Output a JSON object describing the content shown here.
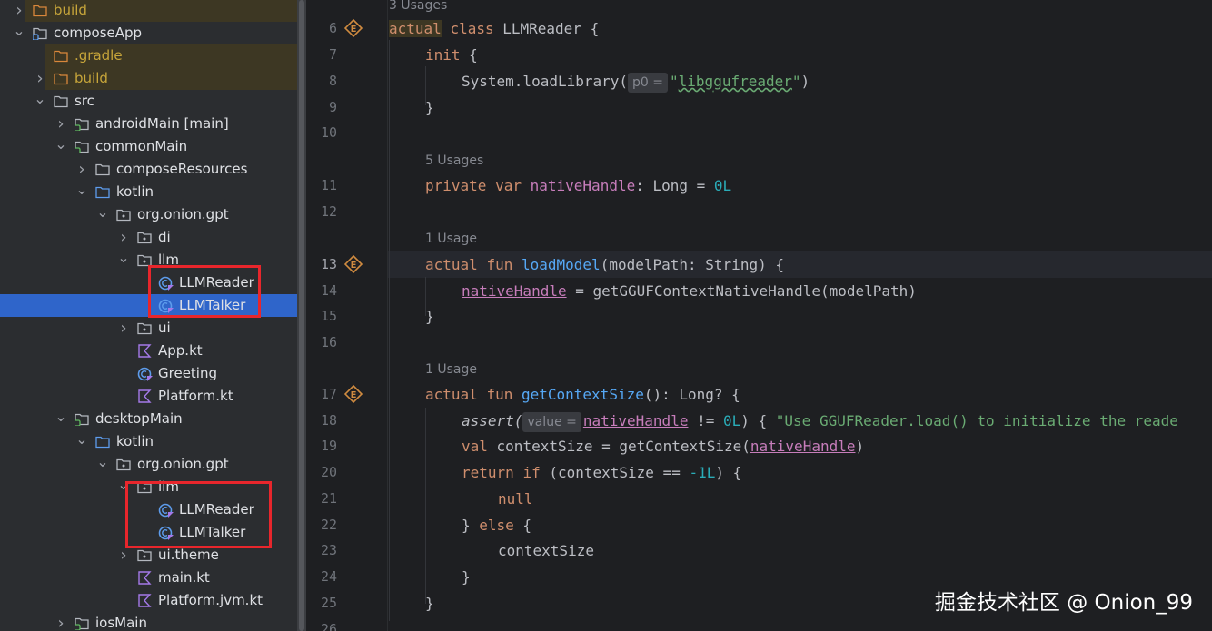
{
  "project_tree": [
    {
      "label": "build",
      "icon": "folder-orange-icon",
      "depth": 0,
      "expanded": false,
      "color": "orange",
      "highlight": true
    },
    {
      "label": "composeApp",
      "icon": "module-icon",
      "depth": 0,
      "expanded": true,
      "color": "white"
    },
    {
      "label": ".gradle",
      "icon": "folder-orange-icon",
      "depth": 1,
      "expanded": null,
      "color": "orange",
      "highlight": true
    },
    {
      "label": "build",
      "icon": "folder-orange-icon",
      "depth": 1,
      "expanded": false,
      "color": "orange",
      "highlight": true
    },
    {
      "label": "src",
      "icon": "folder-icon",
      "depth": 1,
      "expanded": true,
      "color": "white"
    },
    {
      "label": "androidMain [main]",
      "icon": "source-folder-icon",
      "depth": 2,
      "expanded": false,
      "color": "white"
    },
    {
      "label": "commonMain",
      "icon": "source-folder-icon",
      "depth": 2,
      "expanded": true,
      "color": "white"
    },
    {
      "label": "composeResources",
      "icon": "folder-icon",
      "depth": 3,
      "expanded": false,
      "color": "white"
    },
    {
      "label": "kotlin",
      "icon": "folder-blue-icon",
      "depth": 3,
      "expanded": true,
      "color": "white"
    },
    {
      "label": "org.onion.gpt",
      "icon": "package-icon",
      "depth": 4,
      "expanded": true,
      "color": "white"
    },
    {
      "label": "di",
      "icon": "package-icon",
      "depth": 5,
      "expanded": false,
      "color": "white"
    },
    {
      "label": "llm",
      "icon": "package-icon",
      "depth": 5,
      "expanded": true,
      "color": "white"
    },
    {
      "label": "LLMReader",
      "icon": "kotlin-class-icon",
      "depth": 6,
      "expanded": null,
      "color": "white"
    },
    {
      "label": "LLMTalker",
      "icon": "kotlin-class-icon",
      "depth": 6,
      "expanded": null,
      "color": "white",
      "selected": true
    },
    {
      "label": "ui",
      "icon": "package-icon",
      "depth": 5,
      "expanded": false,
      "color": "white"
    },
    {
      "label": "App.kt",
      "icon": "kotlin-file-icon",
      "depth": 5,
      "expanded": null,
      "color": "white"
    },
    {
      "label": "Greeting",
      "icon": "kotlin-class-icon",
      "depth": 5,
      "expanded": null,
      "color": "white"
    },
    {
      "label": "Platform.kt",
      "icon": "kotlin-file-icon",
      "depth": 5,
      "expanded": null,
      "color": "white"
    },
    {
      "label": "desktopMain",
      "icon": "source-folder-icon",
      "depth": 2,
      "expanded": true,
      "color": "white"
    },
    {
      "label": "kotlin",
      "icon": "folder-blue-icon",
      "depth": 3,
      "expanded": true,
      "color": "white"
    },
    {
      "label": "org.onion.gpt",
      "icon": "package-icon",
      "depth": 4,
      "expanded": true,
      "color": "white"
    },
    {
      "label": "llm",
      "icon": "package-icon",
      "depth": 5,
      "expanded": true,
      "color": "white"
    },
    {
      "label": "LLMReader",
      "icon": "kotlin-class-icon",
      "depth": 6,
      "expanded": null,
      "color": "white"
    },
    {
      "label": "LLMTalker",
      "icon": "kotlin-class-icon",
      "depth": 6,
      "expanded": null,
      "color": "white"
    },
    {
      "label": "ui.theme",
      "icon": "package-icon",
      "depth": 5,
      "expanded": false,
      "color": "white"
    },
    {
      "label": "main.kt",
      "icon": "kotlin-file-icon",
      "depth": 5,
      "expanded": null,
      "color": "white"
    },
    {
      "label": "Platform.jvm.kt",
      "icon": "kotlin-file-icon",
      "depth": 5,
      "expanded": null,
      "color": "white"
    },
    {
      "label": "iosMain",
      "icon": "source-folder-icon",
      "depth": 2,
      "expanded": false,
      "color": "white"
    }
  ],
  "editor": {
    "usages": {
      "class": "3 Usages",
      "native_handle": "5 Usages",
      "load_model": "1 Usage",
      "get_context_size": "1 Usage"
    },
    "line_numbers": [
      "6",
      "7",
      "8",
      "9",
      "10",
      "11",
      "12",
      "13",
      "14",
      "15",
      "16",
      "17",
      "18",
      "19",
      "20",
      "21",
      "22",
      "23",
      "24",
      "25",
      "26"
    ],
    "inlay_hints": {
      "p0": "p0 =",
      "value": "value ="
    },
    "code": {
      "l6_kw1": "actual",
      "l6_kw2": "class",
      "l6_name": "LLMReader",
      "l6_rest": " {",
      "l7_kw": "init",
      "l7_rest": " {",
      "l8_call": "System.loadLibrary(",
      "l8_str_q1": "\"",
      "l8_str": "libggufreader",
      "l8_str_q2": "\"",
      "l8_end": ")",
      "l9": "}",
      "l11_kw1": "private",
      "l11_kw2": "var",
      "l11_prop": "nativeHandle",
      "l11_mid": ": Long = ",
      "l11_num": "0L",
      "l13_kw1": "actual",
      "l13_kw2": "fun",
      "l13_fn": "loadModel",
      "l13_rest": "(modelPath: String) {",
      "l14_prop": "nativeHandle",
      "l14_rest": " = getGGUFContextNativeHandle(modelPath)",
      "l15": "}",
      "l17_kw1": "actual",
      "l17_kw2": "fun",
      "l17_fn": "getContextSize",
      "l17_rest": "(): Long? {",
      "l18_call": "assert(",
      "l18_prop": "nativeHandle",
      "l18_mid": " != ",
      "l18_num": "0L",
      "l18_mid2": ") { ",
      "l18_str": "\"Use GGUFReader.load() to initialize the reade",
      "l19_kw": "val",
      "l19_rest": " contextSize = getContextSize(",
      "l19_prop": "nativeHandle",
      "l19_end": ")",
      "l20_kw1": "return",
      "l20_kw2": "if",
      "l20_rest": " (contextSize == ",
      "l20_num": "-1L",
      "l20_end": ") {",
      "l21_kw": "null",
      "l22_a": "} ",
      "l22_kw": "else",
      "l22_b": " {",
      "l23": "contextSize",
      "l24": "}",
      "l25": "}"
    }
  },
  "watermark": "掘金技术社区 @ Onion_99",
  "colors": {
    "selection": "#2f65ca",
    "annotation_box": "#e8262c",
    "keyword": "#cf8e6d",
    "function": "#56a8f5",
    "property": "#c77dbb",
    "string": "#6aab73",
    "number": "#2aacb8"
  }
}
